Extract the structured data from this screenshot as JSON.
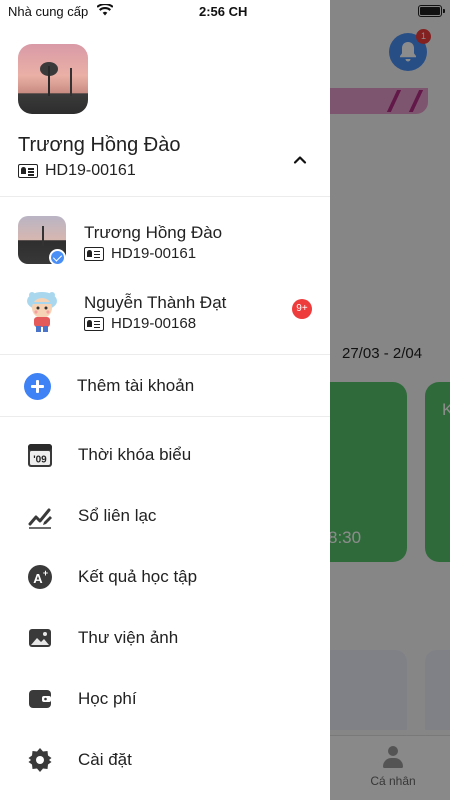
{
  "status_bar": {
    "carrier": "Nhà cung cấp",
    "time": "2:56 CH"
  },
  "background": {
    "notification_count": "1",
    "week_range": "27/03 - 2/04",
    "card_time": "8:30",
    "card_letter": "K",
    "tab_profile": "Cá nhân"
  },
  "drawer": {
    "current_user": {
      "name": "Trương Hồng Đào",
      "id": "HD19-00161"
    },
    "accounts": [
      {
        "name": "Trương Hồng Đào",
        "id": "HD19-00161",
        "selected": true
      },
      {
        "name": "Nguyễn Thành Đạt",
        "id": "HD19-00168",
        "badge": "9+"
      }
    ],
    "add_account_label": "Thêm tài khoản",
    "menu": [
      {
        "label": "Thời khóa biểu",
        "icon": "calendar-09-icon"
      },
      {
        "label": "Sổ liên lạc",
        "icon": "pencil-chart-icon"
      },
      {
        "label": "Kết quả học tập",
        "icon": "grade-icon"
      },
      {
        "label": "Thư viện ảnh",
        "icon": "image-icon"
      },
      {
        "label": "Học phí",
        "icon": "wallet-icon"
      },
      {
        "label": "Cài đặt",
        "icon": "settings-icon"
      }
    ]
  },
  "colors": {
    "accent_blue": "#3f82f5",
    "badge_red": "#ee3b3b",
    "card_green": "#57c46a"
  }
}
